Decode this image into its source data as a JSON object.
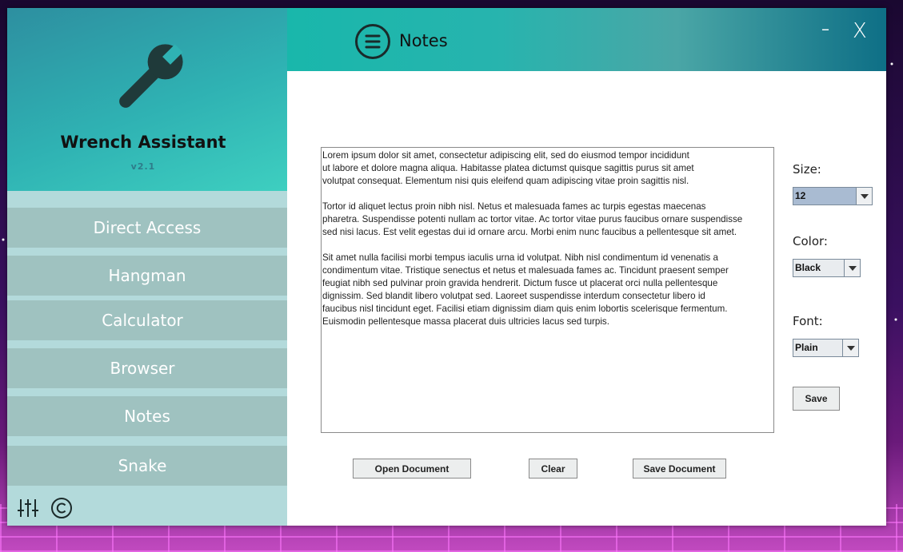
{
  "app": {
    "name": "Wrench Assistant",
    "version": "v2.1"
  },
  "header": {
    "title": "Notes",
    "minimize_label": "–",
    "close_label": "X"
  },
  "sidebar": {
    "items": [
      {
        "label": "Direct Access"
      },
      {
        "label": "Hangman"
      },
      {
        "label": "Calculator"
      },
      {
        "label": "Browser"
      },
      {
        "label": "Notes"
      },
      {
        "label": "Snake"
      }
    ],
    "icons": [
      "sliders-icon",
      "copyright-icon"
    ]
  },
  "editor": {
    "paragraphs": [
      "Lorem ipsum dolor sit amet, consectetur adipiscing elit, sed do eiusmod tempor incididunt\nut labore et dolore magna aliqua. Habitasse platea dictumst quisque sagittis purus sit amet\nvolutpat consequat. Elementum nisi quis eleifend quam adipiscing vitae proin sagittis nisl.",
      "Tortor id aliquet lectus proin nibh nisl. Netus et malesuada fames ac turpis egestas maecenas\npharetra. Suspendisse potenti nullam ac tortor vitae. Ac tortor vitae purus faucibus ornare suspendisse\nsed nisi lacus. Est velit egestas dui id ornare arcu. Morbi enim nunc faucibus a pellentesque sit amet.",
      "Sit amet nulla facilisi morbi tempus iaculis urna id volutpat. Nibh nisl condimentum id venenatis a\ncondimentum vitae. Tristique senectus et netus et malesuada fames ac. Tincidunt praesent semper\nfeugiat nibh sed pulvinar proin gravida hendrerit. Dictum fusce ut placerat orci nulla pellentesque\ndignissim. Sed blandit libero volutpat sed. Laoreet suspendisse interdum consectetur libero id\nfaucibus nisl tincidunt eget. Facilisi etiam dignissim diam quis enim lobortis scelerisque fermentum.\nEuismodin pellentesque massa placerat duis ultricies lacus sed turpis."
    ]
  },
  "options": {
    "size": {
      "label": "Size:",
      "value": "12"
    },
    "color": {
      "label": "Color:",
      "value": "Black"
    },
    "font": {
      "label": "Font:",
      "value": "Plain"
    },
    "save_label": "Save"
  },
  "actions": {
    "open_label": "Open Document",
    "clear_label": "Clear",
    "save_document_label": "Save Document"
  },
  "colors": {
    "sidebar_bg": "#b3dadb",
    "nav_item_bg": "#9fc2c0",
    "header_teal": "#19b7ab",
    "header_dark": "#0e6f86"
  }
}
